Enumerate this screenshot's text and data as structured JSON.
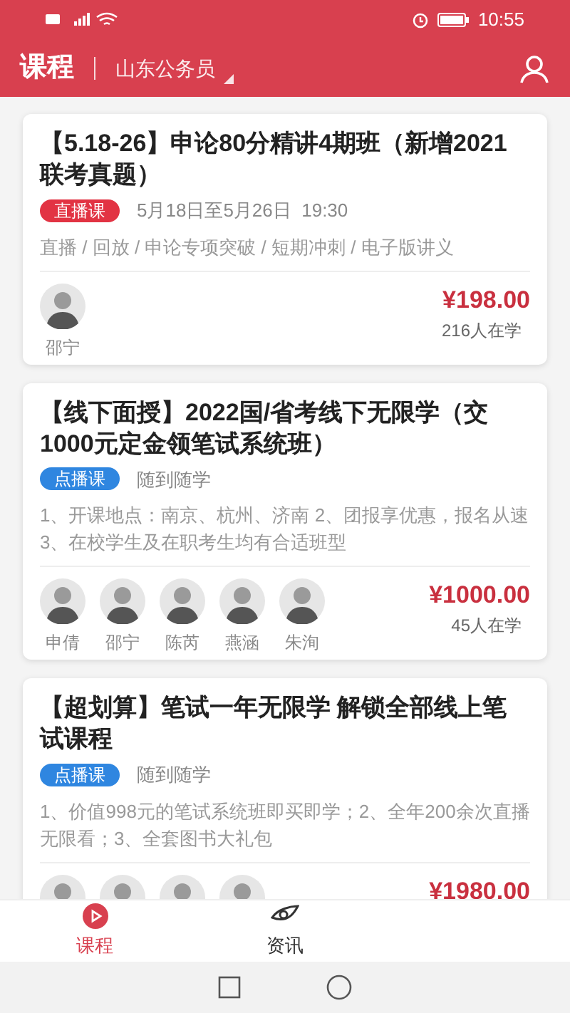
{
  "status_bar": {
    "time": "10:55"
  },
  "header": {
    "title": "课程",
    "region": "山东公务员"
  },
  "courses": [
    {
      "title": "【5.18-26】申论80分精讲4期班（新增2021联考真题）",
      "badge": {
        "kind": "live",
        "label": "直播课"
      },
      "schedule": "5月18日至5月26日  19:30",
      "description": "直播 / 回放 / 申论专项突破 / 短期冲刺 / 电子版讲义",
      "teachers": [
        {
          "name": "邵宁"
        }
      ],
      "price": "¥198.00",
      "students": "216人在学"
    },
    {
      "title": "【线下面授】2022国/省考线下无限学（交1000元定金领笔试系统班）",
      "badge": {
        "kind": "vod",
        "label": "点播课"
      },
      "schedule": "随到随学",
      "description": "1、开课地点：南京、杭州、济南 2、团报享优惠，报名从速 3、在校学生及在职考生均有合适班型",
      "teachers": [
        {
          "name": "申倩"
        },
        {
          "name": "邵宁"
        },
        {
          "name": "陈芮"
        },
        {
          "name": "燕涵"
        },
        {
          "name": "朱洵"
        }
      ],
      "price": "¥1000.00",
      "students": "45人在学"
    },
    {
      "title": "【超划算】笔试一年无限学 解锁全部线上笔试课程",
      "badge": {
        "kind": "vod",
        "label": "点播课"
      },
      "schedule": "随到随学",
      "description": "1、价值998元的笔试系统班即买即学；2、全年200余次直播无限看；3、全套图书大礼包",
      "teachers": [
        {
          "photo": true
        },
        {
          "photo": true
        },
        {
          "photo": true
        },
        {
          "photo": true
        }
      ],
      "price": "¥1980.00"
    }
  ],
  "tabs": [
    {
      "label": "课程",
      "selected": true,
      "kind": "course"
    },
    {
      "label": "资讯",
      "selected": false,
      "kind": "news"
    }
  ]
}
